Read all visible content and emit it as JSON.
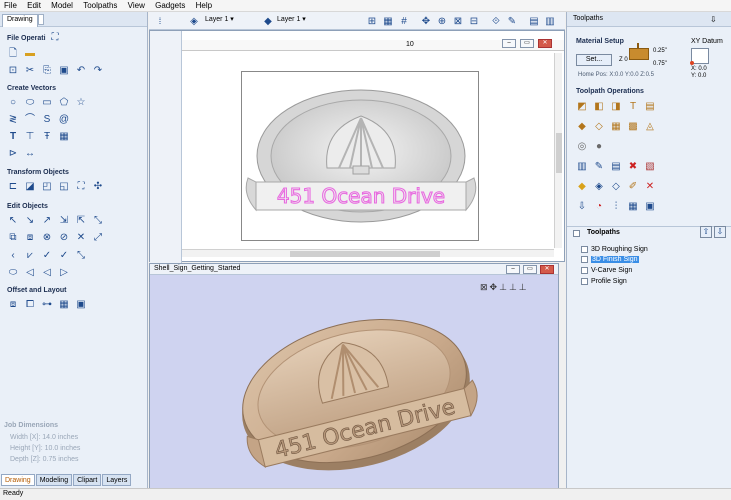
{
  "menu": [
    "File",
    "Edit",
    "Model",
    "Toolpaths",
    "View",
    "Gadgets",
    "Help"
  ],
  "left": {
    "tab": "Drawing",
    "sections": {
      "file": "File Operati",
      "create_vectors": "Create Vectors",
      "transform": "Transform Objects",
      "edit": "Edit Objects",
      "offset": "Offset and Layout"
    },
    "job": {
      "title": "Job Dimensions",
      "width": "Width  [X]: 14.0 inches",
      "height": "Height [Y]: 10.0 inches",
      "depth": "Depth  [Z]: 0.75 inches"
    },
    "bottom_tabs": [
      "Drawing",
      "Modeling",
      "Clipart",
      "Layers"
    ]
  },
  "toolbar": {
    "layer_a": "Layer 1",
    "layer_b": "Layer 1"
  },
  "view2d": {
    "ruler_10": "10",
    "sign_text": "451 Ocean Drive"
  },
  "view3d": {
    "title": "Shell_Sign_Getting_Started",
    "sign_text": "451 Ocean Drive"
  },
  "right": {
    "title": "Toolpaths",
    "material_setup": "Material Setup",
    "set_button": "Set...",
    "z0_label": "Z 0",
    "dim_top": "0.25\"",
    "dim_bottom": "0.75\"",
    "home_pos": "Home Pos:  X:0.0 Y:0.0 Z:0.5",
    "xy_datum": "XY Datum",
    "datum_x": "X: 0.0",
    "datum_y": "Y: 0.0",
    "toolpath_ops": "Toolpath Operations",
    "list_title": "Toolpaths",
    "toolpaths": [
      "3D Roughing Sign",
      "3D Finish Sign",
      "V-Carve Sign",
      "Profile Sign"
    ]
  },
  "status": "Ready",
  "colors": {
    "accent": "#1e4a8c",
    "sign_text_2d": "#e86be0",
    "wood": "#c9a98b",
    "bg3d": "#cfd3f0",
    "selection": "#3a8ee6"
  }
}
